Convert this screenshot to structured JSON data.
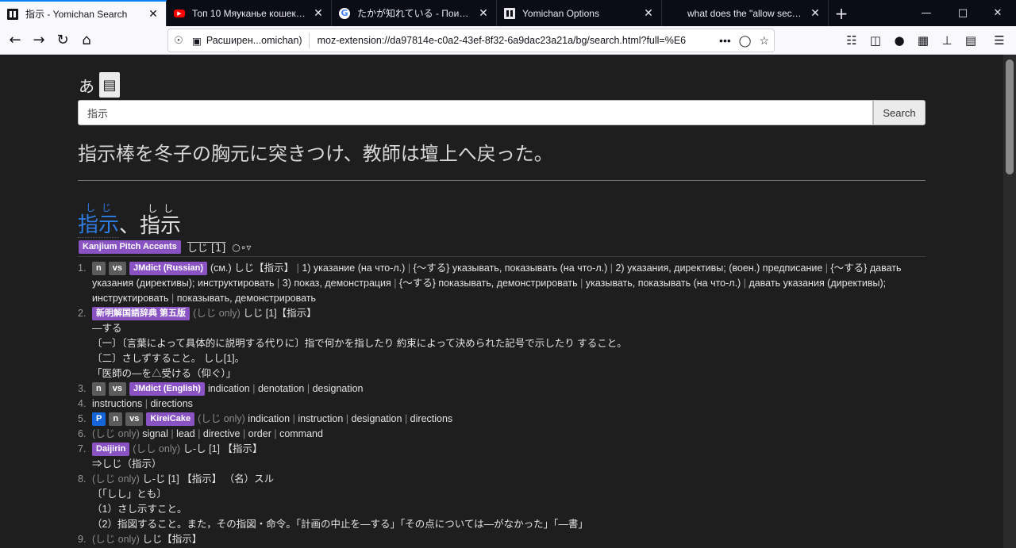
{
  "tabs": [
    {
      "title": "指示 - Yomichan Search",
      "icon": "yomichan-icon",
      "active": true
    },
    {
      "title": "Топ 10 Мяуканье кошек которые",
      "icon": "youtube-icon",
      "active": false
    },
    {
      "title": "たかが知れている - Поиск в Google",
      "icon": "google-icon",
      "active": false
    },
    {
      "title": "Yomichan Options",
      "icon": "yomichan-icon",
      "active": false
    },
    {
      "title": "what does the \"allow secondary",
      "icon": "none",
      "active": false
    }
  ],
  "urlbar": {
    "extension_label": "Расширен...omichan)",
    "url": "moz-extension://da97814e-c0a2-43ef-8f32-6a9dac23a21a/bg/search.html?full=%E6"
  },
  "header": {
    "kana_toggle": "あ",
    "clipboard_icon": "clipboard-icon"
  },
  "search": {
    "value": "指示",
    "button": "Search"
  },
  "sentence": "指示棒を冬子の胸元に突きつけ、教師は壇上へ戻った。",
  "headwords": [
    {
      "kanji": "指示",
      "furigana": "しじ"
    },
    {
      "kanji": "指示",
      "furigana": "しし"
    }
  ],
  "headword_sep": "、",
  "pitch": {
    "tag": "Kanjium Pitch Accents",
    "reading": "しじ [1]"
  },
  "definitions": [
    {
      "num": "1.",
      "tags": [
        {
          "t": "n",
          "c": "grey"
        },
        {
          "t": "vs",
          "c": "grey"
        },
        {
          "t": "JMdict (Russian)",
          "c": "purple"
        }
      ],
      "text": "(см.) しじ【指示】 | 1) указание (на что-л.) | {〜する} указывать, показывать (на что-л.) | 2) указания, директивы; (воен.) предписание | {〜する} давать указания (директивы); инструктировать | 3) показ, демонстрация | {〜する} показывать, демонстрировать | указывать, показывать (на что-л.) | давать указания (директивы); инструктировать | показывать, демонстрировать"
    },
    {
      "num": "2.",
      "tags": [
        {
          "t": "新明解国語辞典 第五版",
          "c": "purple"
        }
      ],
      "only": "(しじ only)",
      "text": "しじ [1]【指示】",
      "extra": [
        "—する",
        "〔一〕〔言葉によって具体的に説明する代りに〕指で何かを指したり 約束によって決められた記号で示したり すること。",
        "〔二〕さしずすること。 しし[1]。",
        "「医師の—を△受ける（仰ぐ）」"
      ]
    },
    {
      "num": "3.",
      "tags": [
        {
          "t": "n",
          "c": "grey"
        },
        {
          "t": "vs",
          "c": "grey"
        },
        {
          "t": "JMdict (English)",
          "c": "purple"
        }
      ],
      "text": "indication | denotation | designation"
    },
    {
      "num": "4.",
      "tags": [],
      "text": "instructions | directions"
    },
    {
      "num": "5.",
      "tags": [
        {
          "t": "P",
          "c": "blue"
        },
        {
          "t": "n",
          "c": "grey"
        },
        {
          "t": "vs",
          "c": "grey"
        },
        {
          "t": "KireiCake",
          "c": "purple"
        }
      ],
      "only": "(しじ only)",
      "text": "indication | instruction | designation | directions"
    },
    {
      "num": "6.",
      "tags": [],
      "only": "(しじ only)",
      "text": "signal | lead | directive | order | command"
    },
    {
      "num": "7.",
      "tags": [
        {
          "t": "Daijirin",
          "c": "purple"
        }
      ],
      "only": "(しし only)",
      "text": "し-し [1] 【指示】",
      "extra": [
        "⇒しじ（指示）"
      ]
    },
    {
      "num": "8.",
      "tags": [],
      "only": "(しじ only)",
      "text": "し-じ [1] 【指示】 （名）スル",
      "extra": [
        "〔「しし」とも〕",
        "（1）さし示すこと。",
        "（2）指図すること。また，その指図・命令。「計画の中止を—する」「その点については—がなかった」「—書」"
      ]
    },
    {
      "num": "9.",
      "tags": [],
      "only": "(しじ only)",
      "text": "しじ【指示】"
    }
  ]
}
